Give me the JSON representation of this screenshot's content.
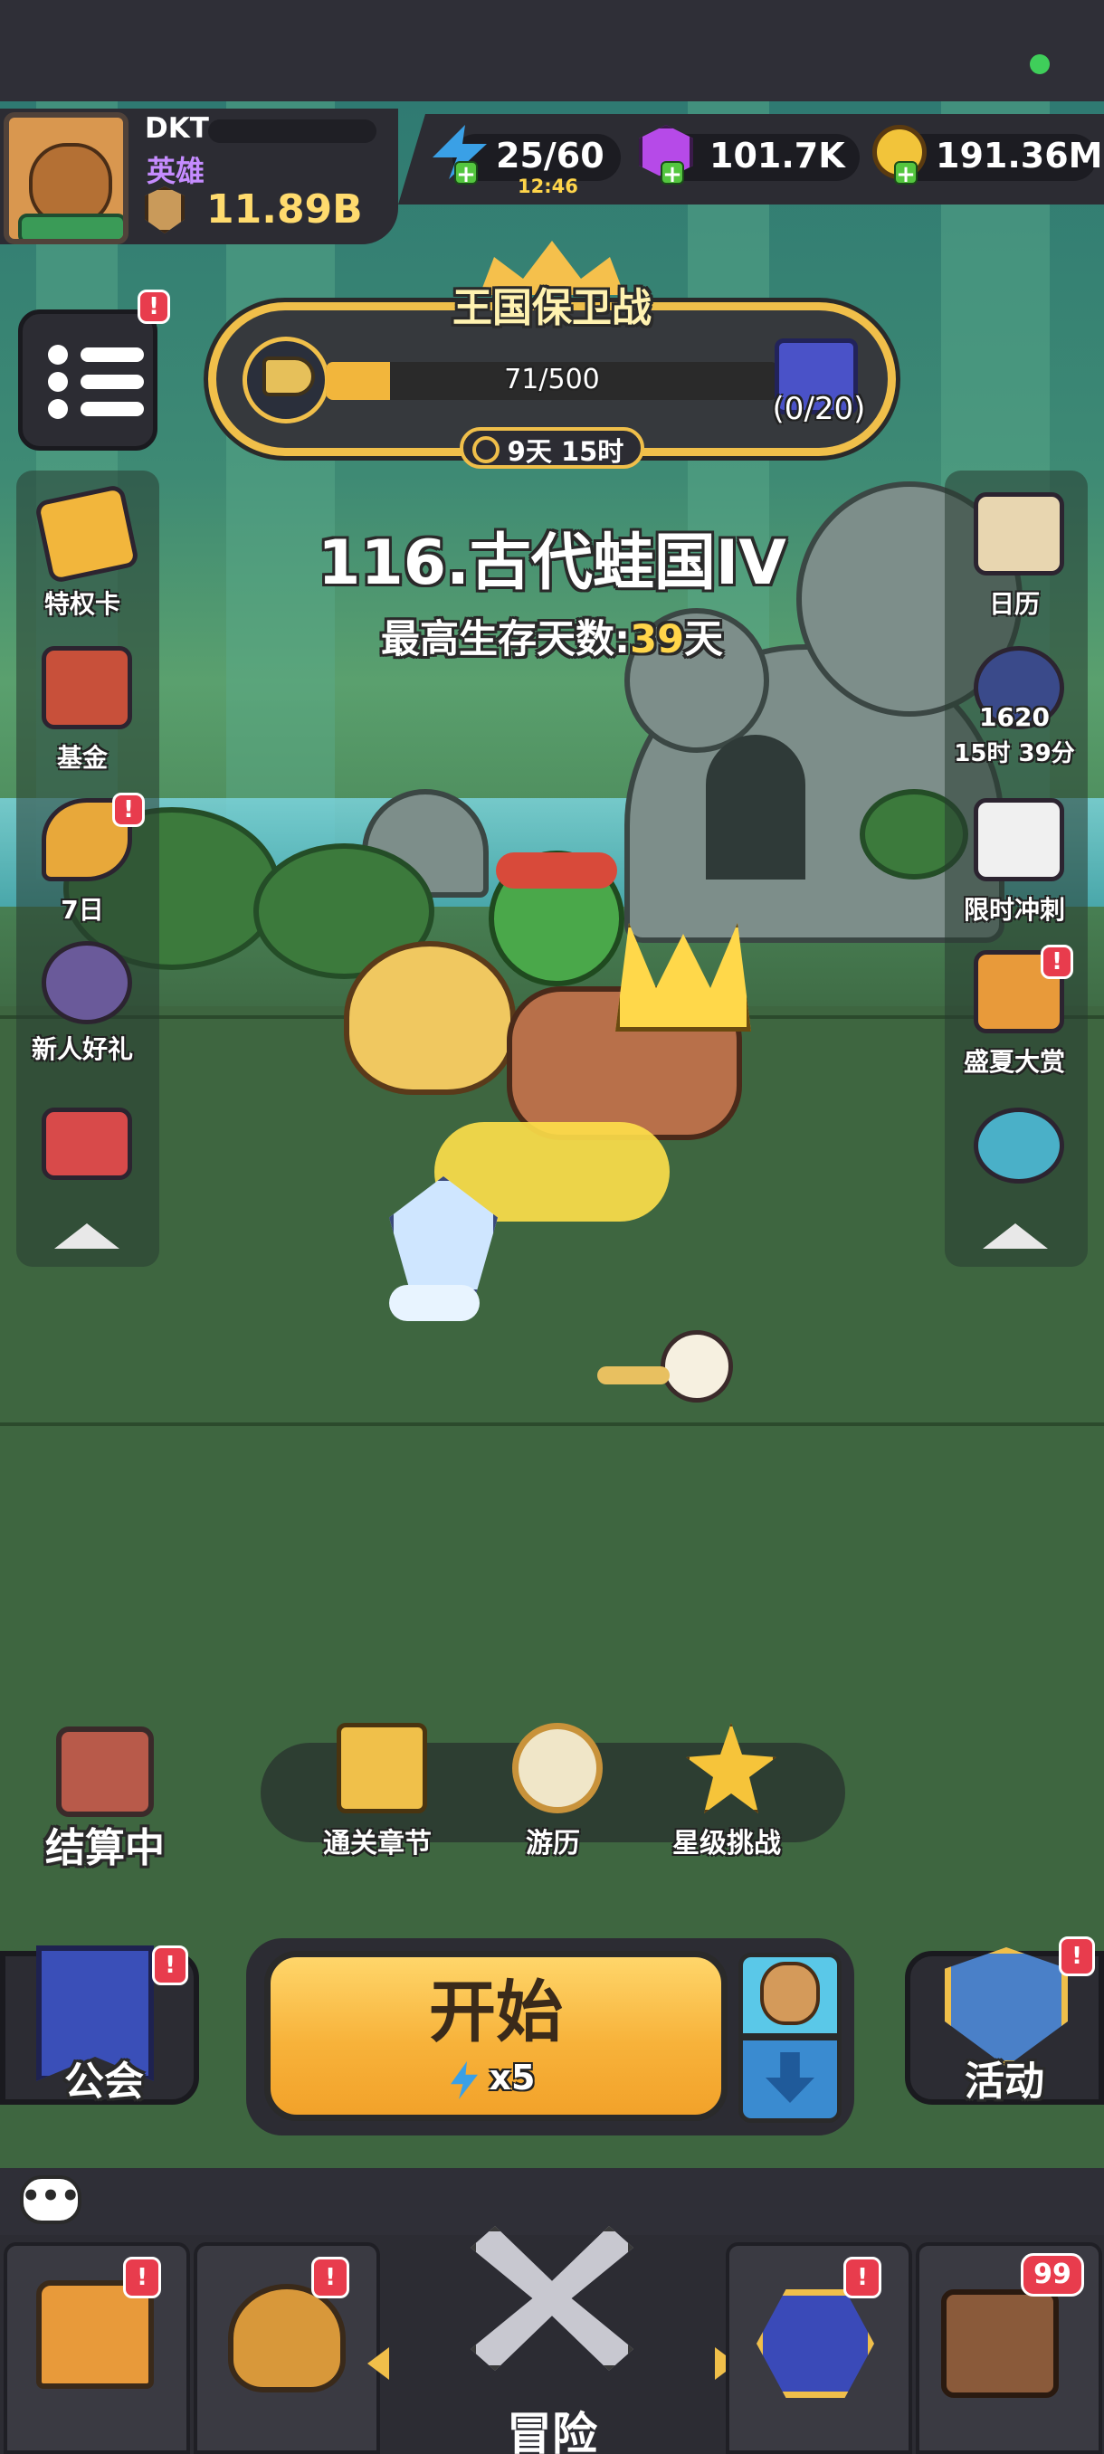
{
  "player": {
    "name": "DKT",
    "rank": "英雄",
    "power": "11.89B"
  },
  "resources": {
    "energy": {
      "value": "25/60",
      "timer": "12:46",
      "icon": "energy-bolt-icon"
    },
    "gems": {
      "value": "101.7K",
      "icon": "purple-gem-icon"
    },
    "coins": {
      "value": "191.36M",
      "icon": "gold-coin-icon"
    }
  },
  "event_banner": {
    "title": "王国保卫战",
    "progress_text": "71/500",
    "progress_fraction": 0.142,
    "reward_count": "(0/20)",
    "timer": "9天 15时"
  },
  "stage": {
    "title": "116.古代蛙国IV",
    "survival_label": "最高生存天数:",
    "survival_days": "39",
    "survival_unit": "天"
  },
  "left_menu": {
    "items": [
      {
        "label": "特权卡",
        "icon": "privilege-card-icon",
        "color": "#f2b63c"
      },
      {
        "label": "基金",
        "icon": "fund-chart-icon",
        "color": "#c8503a"
      },
      {
        "label": "7日",
        "icon": "party-horn-icon",
        "color": "#e8a83a"
      },
      {
        "label": "新人好礼",
        "icon": "newbie-sword-icon",
        "color": "#6a5a9a"
      },
      {
        "label": "",
        "icon": "gift-boxes-icon",
        "color": "#d84a4a"
      }
    ]
  },
  "right_menu": {
    "items": [
      {
        "label": "日历",
        "icon": "calendar-icon",
        "color": "#e8d6b0"
      },
      {
        "label": "1620",
        "sub": "15时 39分",
        "icon": "arena-badge-icon",
        "color": "#3a4a8a"
      },
      {
        "label": "限时冲刺",
        "icon": "limited-calendar-icon",
        "color": "#f0f0f0"
      },
      {
        "label": "盛夏大赏",
        "icon": "summer-shop-icon",
        "color": "#e89a3a"
      },
      {
        "label": "",
        "icon": "pinwheel-icon",
        "color": "#4ab0c8"
      }
    ]
  },
  "modes": [
    {
      "label": "通关章节",
      "icon": "chapter-gate-icon"
    },
    {
      "label": "游历",
      "icon": "compass-icon"
    },
    {
      "label": "星级挑战",
      "icon": "star-trophy-icon"
    }
  ],
  "settle": {
    "label": "结算中",
    "icon": "crossed-swords-icon"
  },
  "start_button": {
    "label": "开始",
    "cost": "x5"
  },
  "guild": {
    "label": "公会"
  },
  "activity": {
    "label": "活动"
  },
  "nav": {
    "battle_label": "冒险",
    "chest_count": "99"
  },
  "colors": {
    "accent_gold": "#f0bf4a",
    "badge_red": "#e83c4d",
    "gem_purple": "#c58cff",
    "power_yellow": "#ffdb6e"
  }
}
